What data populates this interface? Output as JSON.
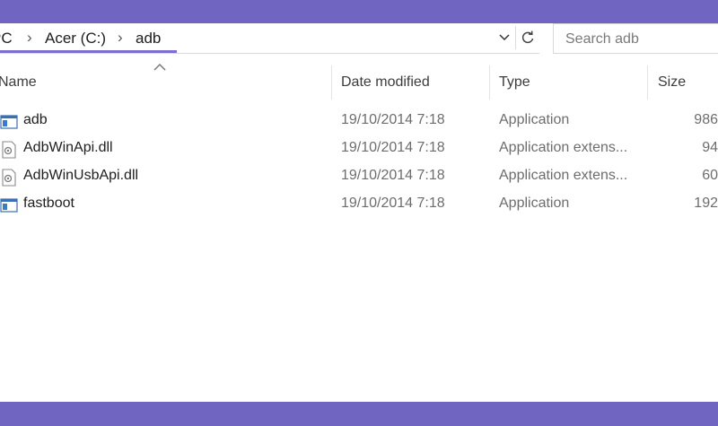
{
  "address": {
    "crumbs": [
      "PC",
      "Acer (C:)",
      "adb"
    ],
    "separator": "›"
  },
  "search": {
    "placeholder": "Search adb"
  },
  "columns": [
    "Name",
    "Date modified",
    "Type",
    "Size"
  ],
  "files": [
    {
      "name": "adb",
      "date": "19/10/2014 7:18",
      "type": "Application",
      "size": "986",
      "icon": "application-icon"
    },
    {
      "name": "AdbWinApi.dll",
      "date": "19/10/2014 7:18",
      "type": "Application extens...",
      "size": "94",
      "icon": "dll-icon"
    },
    {
      "name": "AdbWinUsbApi.dll",
      "date": "19/10/2014 7:18",
      "type": "Application extens...",
      "size": "60",
      "icon": "dll-icon"
    },
    {
      "name": "fastboot",
      "date": "19/10/2014 7:18",
      "type": "Application",
      "size": "192",
      "icon": "application-icon"
    }
  ],
  "colors": {
    "accent_band": "#7066c1",
    "address_underline": "#7b6fd0"
  }
}
